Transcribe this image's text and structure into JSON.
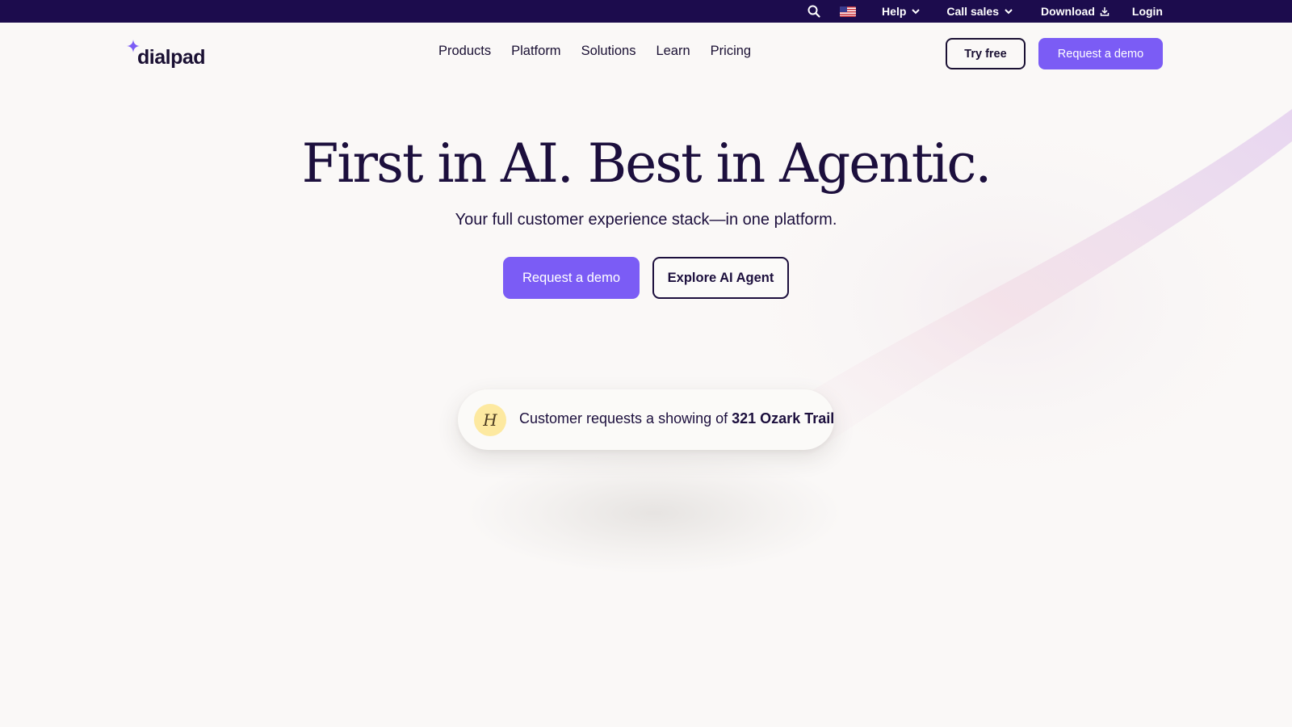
{
  "utility_bar": {
    "help": "Help",
    "call_sales": "Call sales",
    "download": "Download",
    "login": "Login"
  },
  "nav": {
    "logo": "dialpad",
    "links": [
      "Products",
      "Platform",
      "Solutions",
      "Learn",
      "Pricing"
    ],
    "try_free": "Try free",
    "request_demo": "Request a demo"
  },
  "hero": {
    "title": "First in AI. Best in Agentic.",
    "subtitle": "Your full customer experience stack—in one platform.",
    "cta_primary": "Request a demo",
    "cta_secondary": "Explore AI Agent"
  },
  "message_card": {
    "avatar_initial": "H",
    "text_prefix": "Customer requests a showing of ",
    "text_highlight": "321 Ozark Trail"
  },
  "colors": {
    "utility_bar_bg": "#1c0c4d",
    "accent_purple": "#7b5cf5",
    "text_dark": "#1a1033",
    "background": "#faf8f7",
    "avatar_bg": "#fde9a0"
  }
}
